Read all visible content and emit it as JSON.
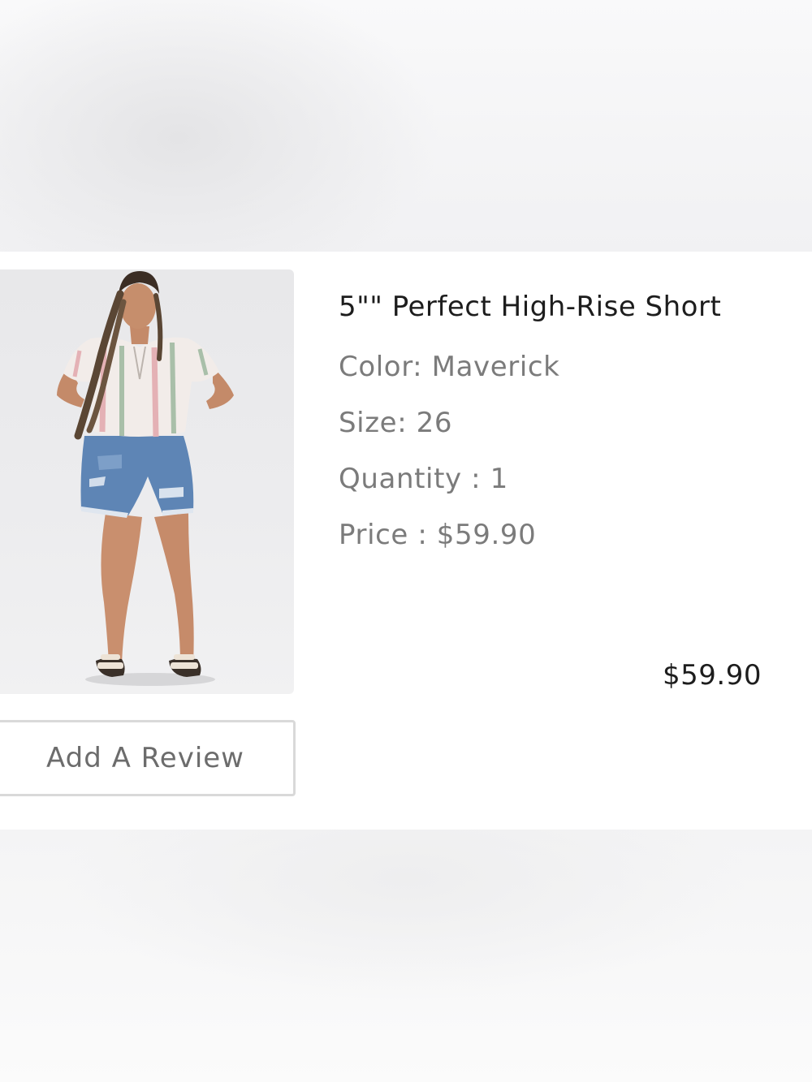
{
  "cart_item": {
    "title": "5\"\" Perfect High-Rise Short",
    "color": "Color: Maverick",
    "size": "Size: 26",
    "quantity": "Quantity : 1",
    "price": "Price : $59.90",
    "line_total": "$59.90",
    "review_button_label": "Add A Review"
  }
}
